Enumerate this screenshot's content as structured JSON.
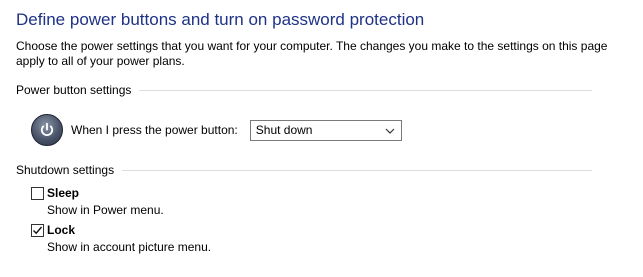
{
  "header": {
    "title": "Define power buttons and turn on password protection",
    "description": "Choose the power settings that you want for your computer. The changes you make to the settings on this page apply to all of your power plans."
  },
  "power_button_settings": {
    "group_label": "Power button settings",
    "power_icon": "power-icon",
    "row_label": "When I press the power button:",
    "dropdown_value": "Shut down"
  },
  "shutdown_settings": {
    "group_label": "Shutdown settings",
    "options": [
      {
        "label": "Sleep",
        "description": "Show in Power menu.",
        "checked": false
      },
      {
        "label": "Lock",
        "description": "Show in account picture menu.",
        "checked": true
      }
    ]
  },
  "colors": {
    "title": "#1e3287",
    "divider": "#dcdcdc"
  }
}
